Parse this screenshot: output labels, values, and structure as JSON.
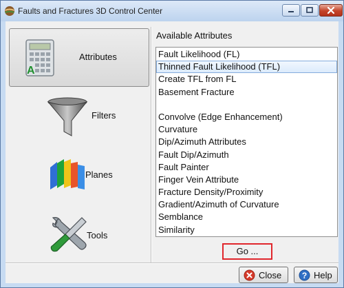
{
  "window": {
    "title": "Faults and Fractures 3D Control Center"
  },
  "nav": [
    {
      "label": "Attributes",
      "icon": "calculator-icon",
      "selected": true
    },
    {
      "label": "Filters",
      "icon": "funnel-icon",
      "selected": false
    },
    {
      "label": "Planes",
      "icon": "planes-icon",
      "selected": false
    },
    {
      "label": "Tools",
      "icon": "tools-icon",
      "selected": false
    }
  ],
  "attributes": {
    "heading": "Available Attributes",
    "items": [
      "Fault Likelihood (FL)",
      "Thinned Fault Likelihood (TFL)",
      "Create TFL from FL",
      "Basement Fracture",
      "",
      "Convolve (Edge Enhancement)",
      "Curvature",
      "Dip/Azimuth Attributes",
      "Fault Dip/Azimuth",
      "Fault Painter",
      "Finger Vein Attribute",
      "Fracture Density/Proximity",
      "Gradient/Azimuth of Curvature",
      "Semblance",
      "Similarity"
    ],
    "selected_item": "Thinned Fault Likelihood (TFL)"
  },
  "buttons": {
    "go": "Go ...",
    "close": "Close",
    "help": "Help"
  },
  "colors": {
    "title_bar": "#c7dbf2",
    "selection": "#dcebfc",
    "go_highlight": "#e0262c",
    "close_icon": "#d63a2a",
    "help_icon": "#2f6fc4"
  }
}
